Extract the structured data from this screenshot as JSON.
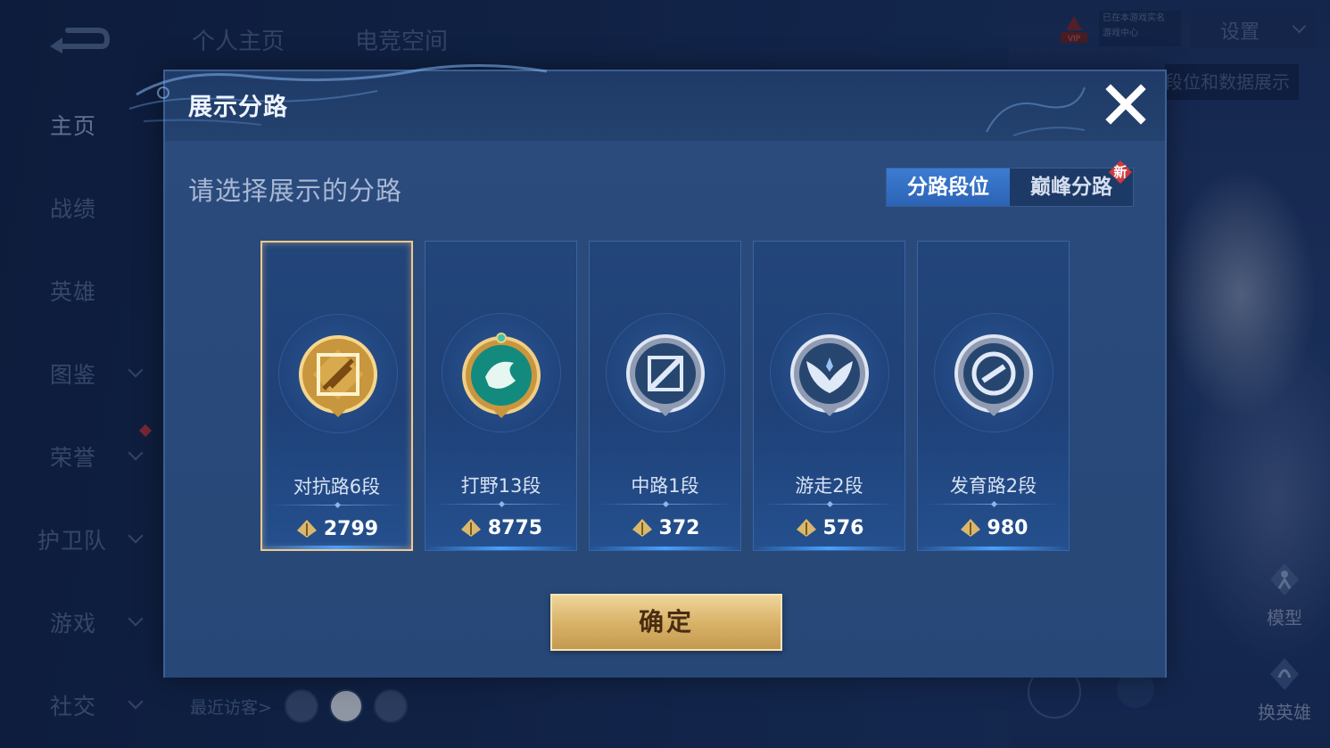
{
  "nav": {
    "back_icon": "back-arrow-icon",
    "top_tabs": [
      "个人主页",
      "电竞空间"
    ],
    "sidebar": [
      {
        "label": "主页",
        "active": true,
        "has_chevron": false
      },
      {
        "label": "战绩",
        "active": false,
        "has_chevron": false
      },
      {
        "label": "英雄",
        "active": false,
        "has_chevron": false
      },
      {
        "label": "图鉴",
        "active": false,
        "has_chevron": true
      },
      {
        "label": "荣誉",
        "active": false,
        "has_chevron": true
      },
      {
        "label": "护卫队",
        "active": false,
        "has_chevron": true
      },
      {
        "label": "游戏",
        "active": false,
        "has_chevron": true
      },
      {
        "label": "社交",
        "active": false,
        "has_chevron": true
      }
    ]
  },
  "header": {
    "vip_label": "VIP",
    "info_line1": "已在本游戏实名",
    "info_line2": "游戏中心",
    "settings_label": "设置",
    "right_label": "段位和数据展示"
  },
  "right_buttons": {
    "model_label": "模型",
    "switch_hero_label": "换英雄"
  },
  "visitors": {
    "label": "最近访客>"
  },
  "modal": {
    "title": "展示分路",
    "subtitle": "请选择展示的分路",
    "segments": [
      "分路段位",
      "巅峰分路"
    ],
    "active_segment": 0,
    "new_badge": "新",
    "cards": [
      {
        "name": "对抗路6段",
        "points": "2799",
        "icon": "clash-lane-gold-badge-icon",
        "selected": true
      },
      {
        "name": "打野13段",
        "points": "8775",
        "icon": "jungle-dragon-badge-icon",
        "selected": false
      },
      {
        "name": "中路1段",
        "points": "372",
        "icon": "mid-lane-silver-badge-icon",
        "selected": false
      },
      {
        "name": "游走2段",
        "points": "576",
        "icon": "roam-wings-badge-icon",
        "selected": false
      },
      {
        "name": "发育路2段",
        "points": "980",
        "icon": "farm-lane-badge-icon",
        "selected": false
      }
    ],
    "confirm_label": "确定"
  },
  "colors": {
    "accent_blue": "#2c63b5",
    "gold": "#d9b36a",
    "selected_border": "#f0c98d"
  }
}
